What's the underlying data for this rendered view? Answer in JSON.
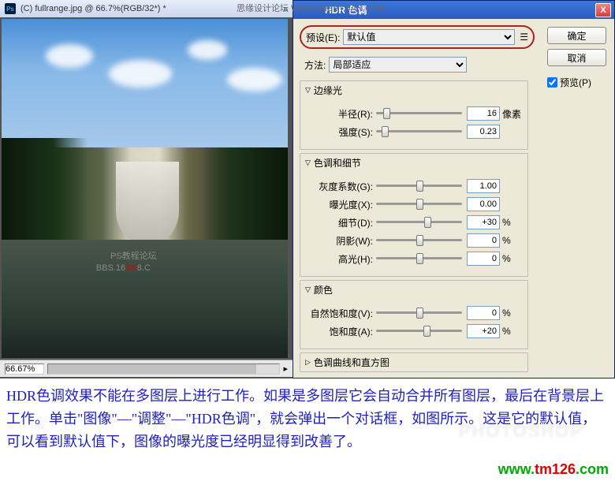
{
  "ps_window": {
    "title": "(C) fullrange.jpg @ 66.7%(RGB/32*) *",
    "zoom": "66.67%",
    "watermark1": "PS教程论坛",
    "watermark2_prefix": "BBS.16",
    "watermark2_red": "XX",
    "watermark2_suffix": "8.C"
  },
  "top_wm": "思缘设计论坛  WWW.MISSYUAN.COM",
  "dialog": {
    "title": "HDR 色调",
    "close": "X",
    "preset_label": "预设(E):",
    "preset_value": "默认值",
    "method_label": "方法:",
    "method_value": "局部适应",
    "ok": "确定",
    "cancel": "取消",
    "preview": "预览(P)",
    "sections": {
      "edge_glow": {
        "title": "边缘光",
        "radius_label": "半径(R):",
        "radius_value": "16",
        "radius_unit": "像素",
        "strength_label": "强度(S):",
        "strength_value": "0.23"
      },
      "tone_detail": {
        "title": "色调和细节",
        "gray_label": "灰度系数(G):",
        "gray_value": "1.00",
        "exposure_label": "曝光度(X):",
        "exposure_value": "0.00",
        "detail_label": "细节(D):",
        "detail_value": "+30",
        "detail_unit": "%",
        "shadow_label": "阴影(W):",
        "shadow_value": "0",
        "shadow_unit": "%",
        "highlight_label": "高光(H):",
        "highlight_value": "0",
        "highlight_unit": "%"
      },
      "color": {
        "title": "颜色",
        "vibrance_label": "自然饱和度(V):",
        "vibrance_value": "0",
        "vibrance_unit": "%",
        "saturation_label": "饱和度(A):",
        "saturation_value": "+20",
        "saturation_unit": "%"
      },
      "curve": {
        "title": "色调曲线和直方图"
      }
    }
  },
  "caption": "HDR色调效果不能在多图层上进行工作。如果是多图层它会自动合并所有图层，最后在背景层上工作。单击\"图像\"—\"调整\"—\"HDR色调\"，就会弹出一个对话框，如图所示。这是它的默认值，可以看到默认值下，图像的曝光度已经明显得到改善了。",
  "wm_photoshop": "PHOTOSHOP",
  "wm_tm_g": "www.",
  "wm_tm_r": "tm126",
  "wm_tm_g2": ".com"
}
